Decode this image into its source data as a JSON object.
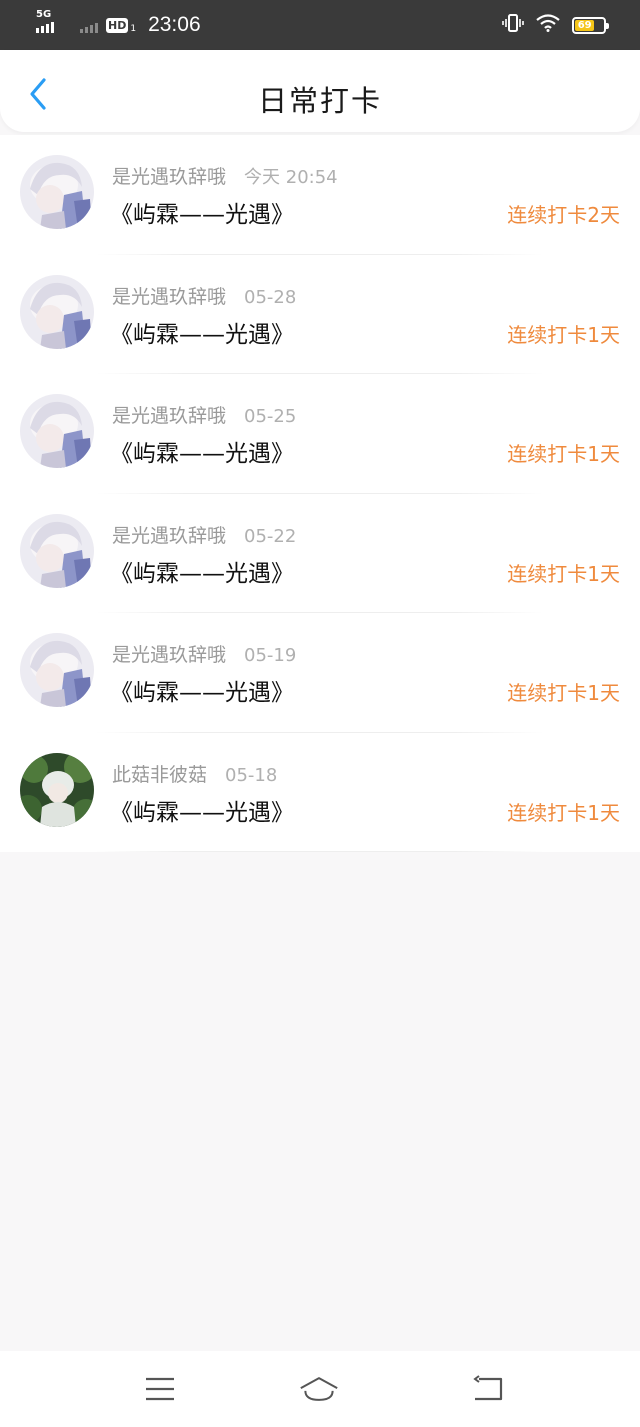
{
  "status_bar": {
    "network": "5G",
    "hd": "HD",
    "hd_sub": "1",
    "time": "23:06",
    "battery": "69",
    "battery_level": 0.69
  },
  "header": {
    "title": "日常打卡",
    "back_icon": "chevron-left-icon"
  },
  "colors": {
    "accent_blue": "#2a9df4",
    "streak_orange": "#ef8a3d",
    "status_bar_bg": "#3a3a3a"
  },
  "checkins": [
    {
      "user": "是光遇玖辞哦",
      "date": "今天 20:54",
      "title": "《屿霖——光遇》",
      "streak": "连续打卡2天",
      "avatar": "anime-avatar-light"
    },
    {
      "user": "是光遇玖辞哦",
      "date": "05-28",
      "title": "《屿霖——光遇》",
      "streak": "连续打卡1天",
      "avatar": "anime-avatar-light"
    },
    {
      "user": "是光遇玖辞哦",
      "date": "05-25",
      "title": "《屿霖——光遇》",
      "streak": "连续打卡1天",
      "avatar": "anime-avatar-light"
    },
    {
      "user": "是光遇玖辞哦",
      "date": "05-22",
      "title": "《屿霖——光遇》",
      "streak": "连续打卡1天",
      "avatar": "anime-avatar-light"
    },
    {
      "user": "是光遇玖辞哦",
      "date": "05-19",
      "title": "《屿霖——光遇》",
      "streak": "连续打卡1天",
      "avatar": "anime-avatar-light"
    },
    {
      "user": "此菇非彼菇",
      "date": "05-18",
      "title": "《屿霖——光遇》",
      "streak": "连续打卡1天",
      "avatar": "anime-avatar-green"
    }
  ],
  "bottom_nav": {
    "menu_icon": "menu-icon",
    "home_icon": "home-icon",
    "back_icon": "back-icon"
  }
}
